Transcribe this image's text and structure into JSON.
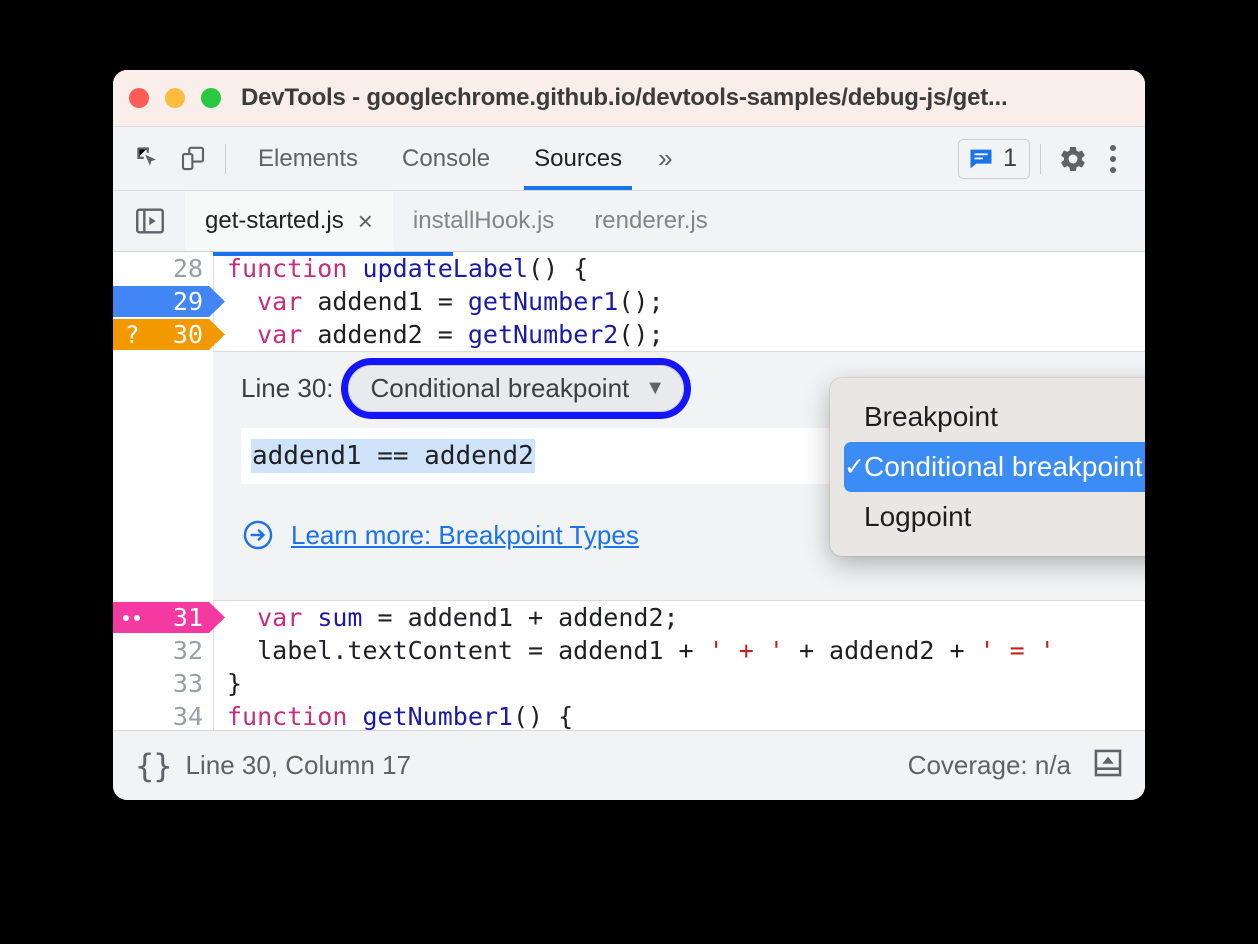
{
  "window": {
    "title": "DevTools - googlechrome.github.io/devtools-samples/debug-js/get...",
    "traffic_lights": [
      "close",
      "minimize",
      "maximize"
    ],
    "colors": {
      "red": "#fc5d55",
      "yellow": "#fdbc40",
      "green": "#28c840",
      "titlebar_bg": "#faeeea"
    }
  },
  "toolbar": {
    "inspect_icon": "inspect-element-icon",
    "device_icon": "device-toolbar-icon",
    "panels": [
      {
        "label": "Elements",
        "active": false
      },
      {
        "label": "Console",
        "active": false
      },
      {
        "label": "Sources",
        "active": true
      }
    ],
    "overflow_label": "»",
    "message_count": "1",
    "message_icon": "console-message-icon",
    "settings_icon": "gear-icon",
    "more_icon": "kebab-menu-icon",
    "accent": "#1a73e8"
  },
  "file_tabs": {
    "navigator_icon": "show-navigator-icon",
    "items": [
      {
        "label": "get-started.js",
        "active": true,
        "closable": true,
        "close_glyph": "×"
      },
      {
        "label": "installHook.js",
        "active": false,
        "closable": false
      },
      {
        "label": "renderer.js",
        "active": false,
        "closable": false
      }
    ]
  },
  "editor": {
    "lines": [
      {
        "number": "28",
        "marker": "none",
        "tokens": [
          {
            "t": "function ",
            "c": "kw"
          },
          {
            "t": "updateLabel",
            "c": "fn"
          },
          {
            "t": "() {",
            "c": "plain"
          }
        ]
      },
      {
        "number": "29",
        "marker": "breakpoint",
        "marker_color": "#4285f4",
        "marker_glyph": "",
        "tokens": [
          {
            "t": "  ",
            "c": "plain"
          },
          {
            "t": "var ",
            "c": "kw"
          },
          {
            "t": "addend1 = ",
            "c": "plain"
          },
          {
            "t": "getNumber1",
            "c": "fn"
          },
          {
            "t": "();",
            "c": "plain"
          }
        ]
      },
      {
        "number": "30",
        "marker": "conditional-breakpoint",
        "marker_color": "#f29900",
        "marker_glyph": "?",
        "tokens": [
          {
            "t": "  ",
            "c": "plain"
          },
          {
            "t": "var ",
            "c": "kw"
          },
          {
            "t": "addend2 = ",
            "c": "plain"
          },
          {
            "t": "getNumber2",
            "c": "fn"
          },
          {
            "t": "();",
            "c": "plain"
          }
        ]
      },
      {
        "number": "31",
        "marker": "logpoint",
        "marker_color": "#f439a0",
        "marker_glyph": "..",
        "tokens": [
          {
            "t": "  ",
            "c": "plain"
          },
          {
            "t": "var ",
            "c": "kw"
          },
          {
            "t": "sum",
            "c": "fn"
          },
          {
            "t": " = addend1 + addend2;",
            "c": "plain"
          }
        ]
      },
      {
        "number": "32",
        "marker": "none",
        "tokens": [
          {
            "t": "  label.textContent = addend1 + ",
            "c": "plain"
          },
          {
            "t": "' + '",
            "c": "str"
          },
          {
            "t": " + addend2 + ",
            "c": "plain"
          },
          {
            "t": "' = '",
            "c": "str"
          }
        ]
      },
      {
        "number": "33",
        "marker": "none",
        "tokens": [
          {
            "t": "}",
            "c": "plain"
          }
        ]
      },
      {
        "number": "34",
        "marker": "none",
        "tokens": [
          {
            "t": "function ",
            "c": "kw"
          },
          {
            "t": "getNumber1",
            "c": "fn"
          },
          {
            "t": "() {",
            "c": "plain"
          }
        ]
      }
    ]
  },
  "breakpoint_editor": {
    "line_label": "Line 30:",
    "select_value": "Conditional breakpoint",
    "select_caret": "▼",
    "condition_value": "addend1 == addend2",
    "condition_selected": true,
    "learn_icon": "arrow-right-circle-icon",
    "learn_label": "Learn more: Breakpoint Types",
    "focus_ring_color": "#1414ff"
  },
  "dropdown": {
    "items": [
      {
        "label": "Breakpoint",
        "selected": false
      },
      {
        "label": "Conditional breakpoint",
        "selected": true,
        "check": "✓"
      },
      {
        "label": "Logpoint",
        "selected": false
      }
    ],
    "highlight_color": "#3b8cf4",
    "menu_bg": "#e9e6e4"
  },
  "statusbar": {
    "pretty_print_icon": "{}",
    "cursor_position": "Line 30, Column 17",
    "coverage": "Coverage: n/a",
    "drawer_icon": "show-drawer-icon"
  }
}
